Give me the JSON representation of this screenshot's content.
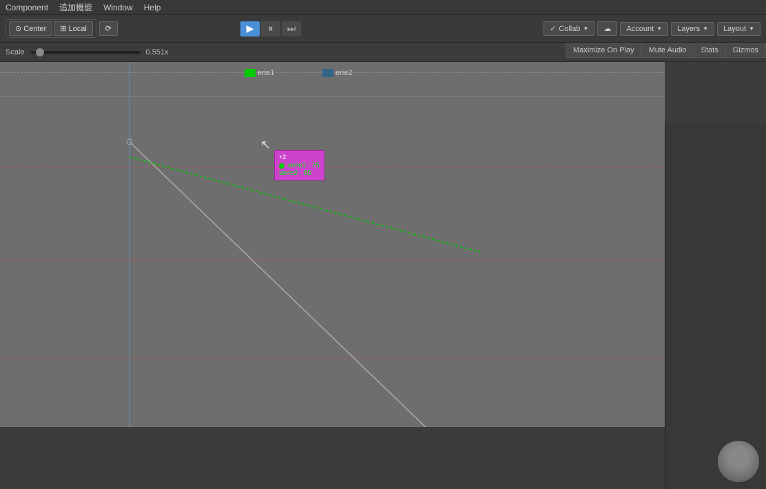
{
  "menubar": {
    "items": [
      "Component",
      "追加機能",
      "Window",
      "Help"
    ]
  },
  "toolbar": {
    "center_label": "Center",
    "local_label": "Local",
    "transform_label": "⟳",
    "collab_label": "Collab",
    "account_label": "Account",
    "layers_label": "Layers",
    "layout_label": "Layout"
  },
  "playcontrols": {
    "play_icon": "▶",
    "pause_icon": "⏸",
    "step_icon": "⏭"
  },
  "scalebar": {
    "label": "Scale",
    "value": "0.551x"
  },
  "actionbar": {
    "maximize_label": "Maximize On Play",
    "mute_label": "Mute Audio",
    "stats_label": "Stats",
    "gizmos_label": "Gizmos"
  },
  "legend": {
    "serie1_label": "erie1",
    "serie2_label": "erie2",
    "serie1_color": "#00cc00",
    "serie2_color": "#336688"
  },
  "tooltip": {
    "header": "+2",
    "line1": "serie1 : 75",
    "line2": "serie2 : 66"
  },
  "viewport": {
    "bg_color": "#6e6e6e"
  }
}
